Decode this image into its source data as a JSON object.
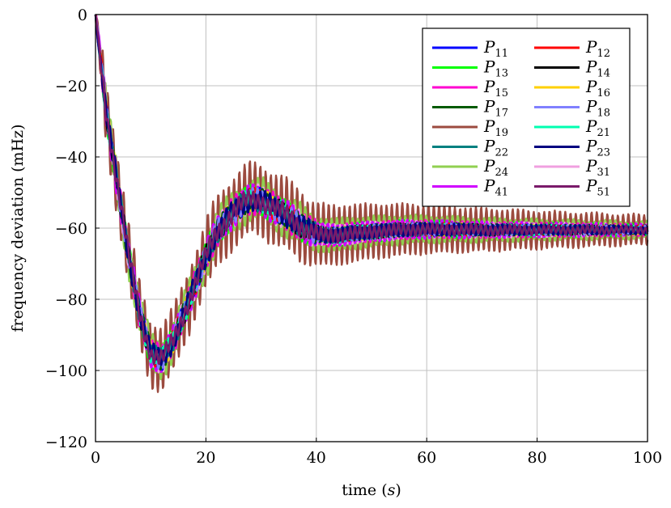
{
  "chart_data": {
    "type": "line",
    "title": "",
    "xlabel": "time (s)",
    "ylabel": "frequency deviation (mHz)",
    "xlim": [
      0,
      100
    ],
    "ylim": [
      -120,
      0
    ],
    "xticks": [
      "0",
      "20",
      "40",
      "60",
      "80",
      "100"
    ],
    "yticks": [
      "0",
      "−20",
      "−40",
      "−60",
      "−80",
      "−100",
      "−120"
    ],
    "grid": true,
    "legend_position": "top-right",
    "legend_columns": 2,
    "approximate_mean_trajectory": {
      "x": [
        0,
        2,
        4,
        6,
        8,
        10,
        12,
        14,
        16,
        18,
        20,
        22,
        24,
        26,
        28,
        30,
        32,
        34,
        36,
        38,
        40,
        42,
        44,
        46,
        50,
        55,
        60,
        70,
        80,
        90,
        100
      ],
      "y": [
        0,
        -28,
        -48,
        -68,
        -84,
        -95,
        -97,
        -92,
        -84,
        -76,
        -68,
        -61,
        -57,
        -54,
        -52,
        -52,
        -54,
        -56,
        -58,
        -60,
        -61.5,
        -62,
        -62,
        -61.5,
        -61,
        -60.5,
        -60.3,
        -60.5,
        -60.5,
        -60.5,
        -60.5
      ]
    },
    "series": [
      {
        "name": "P_11",
        "color": "#0000ff",
        "oscillation_mHz": 2
      },
      {
        "name": "P_12",
        "color": "#ff0000",
        "oscillation_mHz": 2
      },
      {
        "name": "P_13",
        "color": "#00ff00",
        "oscillation_mHz": 3
      },
      {
        "name": "P_14",
        "color": "#000000",
        "oscillation_mHz": 2
      },
      {
        "name": "P_15",
        "color": "#ff00d0",
        "oscillation_mHz": 3
      },
      {
        "name": "P_16",
        "color": "#ffd000",
        "oscillation_mHz": 2
      },
      {
        "name": "P_17",
        "color": "#005a00",
        "oscillation_mHz": 2
      },
      {
        "name": "P_18",
        "color": "#8080ff",
        "oscillation_mHz": 2
      },
      {
        "name": "P_19",
        "color": "#9c4b3f",
        "oscillation_mHz": 9
      },
      {
        "name": "P_21",
        "color": "#00ffb0",
        "oscillation_mHz": 2
      },
      {
        "name": "P_22",
        "color": "#008080",
        "oscillation_mHz": 2
      },
      {
        "name": "P_23",
        "color": "#000080",
        "oscillation_mHz": 2
      },
      {
        "name": "P_24",
        "color": "#90d050",
        "oscillation_mHz": 5
      },
      {
        "name": "P_31",
        "color": "#f0a0e0",
        "oscillation_mHz": 3
      },
      {
        "name": "P_41",
        "color": "#d000ff",
        "oscillation_mHz": 3
      },
      {
        "name": "P_51",
        "color": "#7a1a6a",
        "oscillation_mHz": 2
      }
    ]
  }
}
